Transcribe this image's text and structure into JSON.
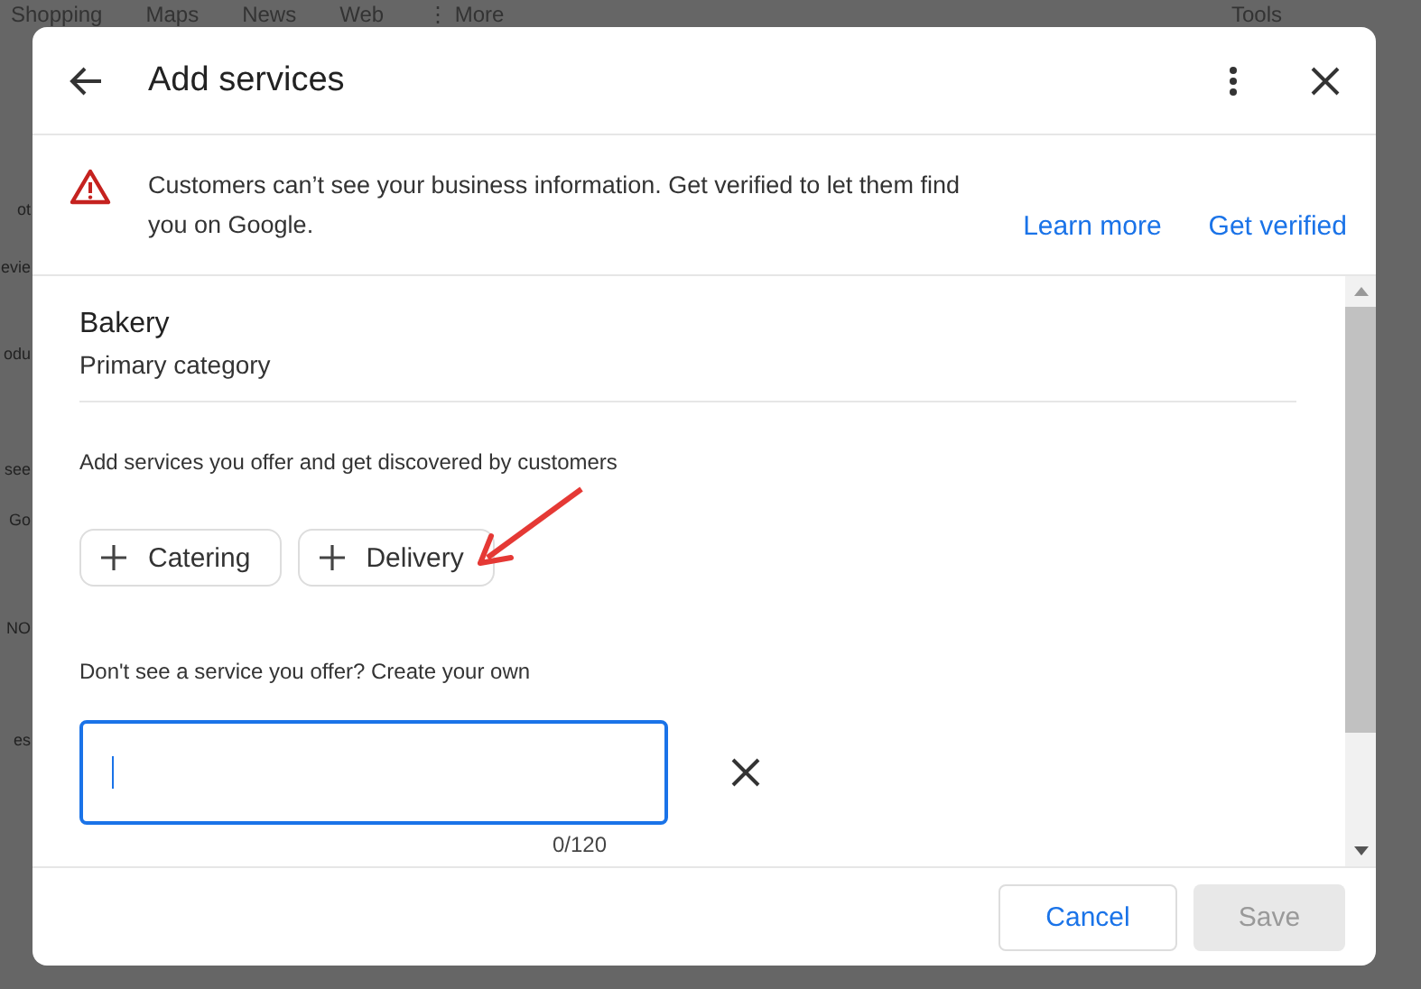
{
  "background": {
    "tabs": [
      "Shopping",
      "Maps",
      "News",
      "Web",
      "⋮ More"
    ],
    "tools": "Tools",
    "fragments": [
      "ot",
      "evie",
      "odu",
      "see",
      "Go",
      "NO",
      "es"
    ]
  },
  "dialog": {
    "title": "Add services",
    "banner": {
      "message": "Customers can’t see your business information. Get verified to let them find you on Google.",
      "links": [
        "Learn more",
        "Get verified"
      ]
    },
    "category": {
      "name": "Bakery",
      "label": "Primary category"
    },
    "services_hint": "Add services you offer and get discovered by customers",
    "chips": [
      {
        "label": "Catering"
      },
      {
        "label": "Delivery"
      }
    ],
    "custom_hint": "Don't see a service you offer? Create your own",
    "custom_field": {
      "focused": true,
      "counter": "0/120"
    },
    "buttons": [
      {
        "label": "Cancel",
        "disabled": false
      },
      {
        "label": "Save",
        "disabled": true
      }
    ]
  }
}
